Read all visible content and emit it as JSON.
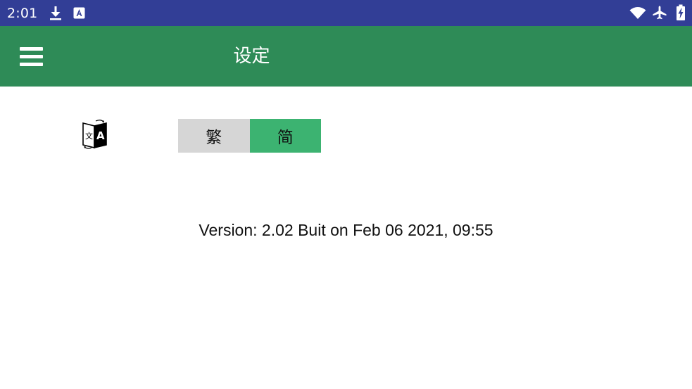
{
  "status_bar": {
    "time": "2:01",
    "icons": {
      "left": [
        "download-icon",
        "a-app-icon"
      ],
      "right": [
        "wifi-icon",
        "airplane-icon",
        "battery-charging-icon"
      ]
    },
    "background": "#323e96"
  },
  "app_bar": {
    "title": "设定",
    "background": "#2e8b57",
    "menu_icon": "hamburger-menu-icon"
  },
  "settings": {
    "language_icon": "translate-language-icon",
    "language_options": [
      "繁",
      "简"
    ],
    "selected_language": "简",
    "selected_color": "#3cb371",
    "unselected_color": "#d6d6d6"
  },
  "version_text": "Version: 2.02 Buit on Feb 06 2021, 09:55"
}
